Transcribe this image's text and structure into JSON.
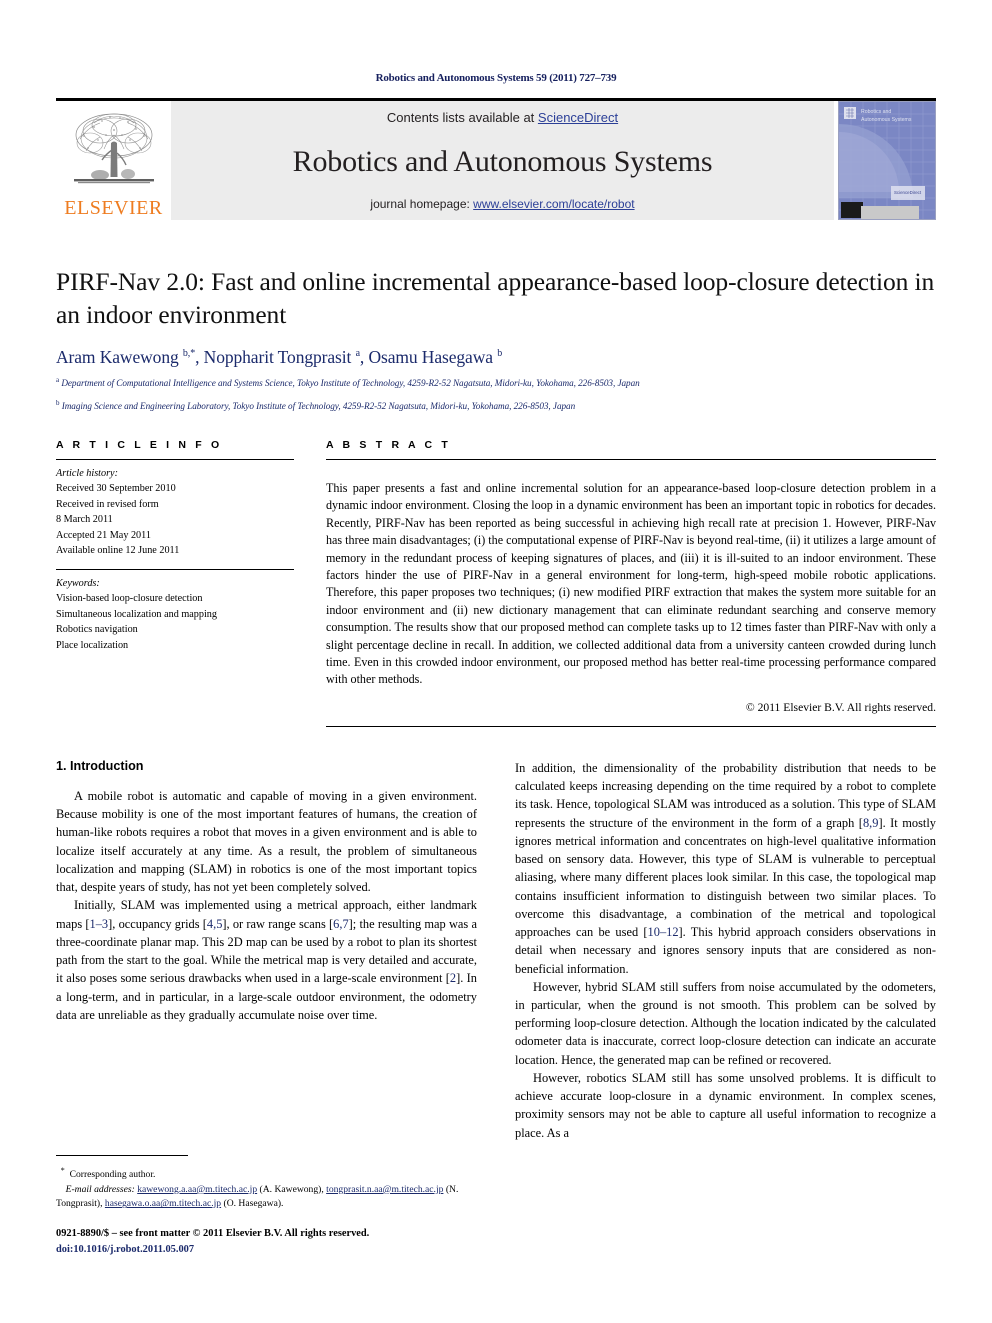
{
  "running_head": "Robotics and Autonomous Systems 59 (2011) 727–739",
  "masthead": {
    "publisher_name": "ELSEVIER",
    "contents_prefix": "Contents lists available at ",
    "contents_link": "ScienceDirect",
    "journal_name": "Robotics and Autonomous Systems",
    "homepage_prefix": "journal homepage: ",
    "homepage_link": "www.elsevier.com/locate/robot",
    "cover_title_line1": "Robotics and",
    "cover_title_line2": "Autonomous Systems",
    "cover_badge": "ScienceDirect"
  },
  "article": {
    "title": "PIRF-Nav 2.0: Fast and online incremental appearance-based loop-closure detection in an indoor environment",
    "authors_html": "Aram Kawewong <sup>b,*</sup>, Noppharit Tongprasit <sup>a</sup>, Osamu Hasegawa <sup>b</sup>",
    "affiliation_a": "Department of Computational Intelligence and Systems Science, Tokyo Institute of Technology, 4259-R2-52 Nagatsuta, Midori-ku, Yokohama, 226-8503, Japan",
    "affiliation_b": "Imaging Science and Engineering Laboratory, Tokyo Institute of Technology, 4259-R2-52 Nagatsuta, Midori-ku, Yokohama, 226-8503, Japan"
  },
  "article_info": {
    "heading": "A R T I C L E   I N F O",
    "history_label": "Article history:",
    "history": [
      "Received 30 September 2010",
      "Received in revised form",
      "8 March 2011",
      "Accepted 21 May 2011",
      "Available online 12 June 2011"
    ],
    "keywords_label": "Keywords:",
    "keywords": [
      "Vision-based loop-closure detection",
      "Simultaneous localization and mapping",
      "Robotics navigation",
      "Place localization"
    ]
  },
  "abstract": {
    "heading": "A B S T R A C T",
    "text": "This paper presents a fast and online incremental solution for an appearance-based loop-closure detection problem in a dynamic indoor environment. Closing the loop in a dynamic environment has been an important topic in robotics for decades. Recently, PIRF-Nav has been reported as being successful in achieving high recall rate at precision 1. However, PIRF-Nav has three main disadvantages; (i) the computational expense of PIRF-Nav is beyond real-time, (ii) it utilizes a large amount of memory in the redundant process of keeping signatures of places, and (iii) it is ill-suited to an indoor environment. These factors hinder the use of PIRF-Nav in a general environment for long-term, high-speed mobile robotic applications. Therefore, this paper proposes two techniques; (i) new modified PIRF extraction that makes the system more suitable for an indoor environment and (ii) new dictionary management that can eliminate redundant searching and conserve memory consumption. The results show that our proposed method can complete tasks up to 12 times faster than PIRF-Nav with only a slight percentage decline in recall. In addition, we collected additional data from a university canteen crowded during lunch time. Even in this crowded indoor environment, our proposed method has better real-time processing performance compared with other methods.",
    "copyright": "© 2011 Elsevier B.V. All rights reserved."
  },
  "body": {
    "section_title": "1.  Introduction",
    "left_paragraphs": [
      "A mobile robot is automatic and capable of moving in a given environment. Because mobility is one of the most important features of humans, the creation of human-like robots requires a robot that moves in a given environment and is able to localize itself accurately at any time. As a result, the problem of simultaneous localization and mapping (SLAM) in robotics is one of the most important topics that, despite years of study, has not yet been completely solved."
    ],
    "left_para2_parts": {
      "t1": "Initially, SLAM was implemented using a metrical approach, either landmark maps [",
      "r1": "1–3",
      "t2": "], occupancy grids [",
      "r2": "4,5",
      "t3": "], or raw range scans [",
      "r3": "6,7",
      "t4": "]; the resulting map was a three-coordinate planar map. This 2D map can be used by a robot to plan its shortest path from the start to the goal. While the metrical map is very detailed and accurate, it also poses some serious drawbacks when used in a large-scale environment [",
      "r4": "2",
      "t5": "]. In a long-term, and in particular, in a large-scale outdoor environment, the odometry data are unreliable as they gradually accumulate noise over time."
    },
    "right_para1_parts": {
      "t1": "In addition, the dimensionality of the probability distribution that needs to be calculated keeps increasing depending on the time required by a robot to complete its task. Hence, topological SLAM was introduced as a solution. This type of SLAM represents the structure of the environment in the form of a graph [",
      "r1": "8,9",
      "t2": "]. It mostly ignores metrical information and concentrates on high-level qualitative information based on sensory data. However, this type of SLAM is vulnerable to perceptual aliasing, where many different places look similar. In this case, the topological map contains insufficient information to distinguish between two similar places. To overcome this disadvantage, a combination of the metrical and topological approaches can be used [",
      "r2": "10–12",
      "t3": "]. This hybrid approach considers observations in detail when necessary and ignores sensory inputs that are considered as non-beneficial information."
    },
    "right_paragraphs": [
      "However, hybrid SLAM still suffers from noise accumulated by the odometers, in particular, when the ground is not smooth. This problem can be solved by performing loop-closure detection. Although the location indicated by the calculated odometer data is inaccurate, correct loop-closure detection can indicate an accurate location. Hence, the generated map can be refined or recovered.",
      "However, robotics SLAM still has some unsolved problems. It is difficult to achieve accurate loop-closure in a dynamic environment. In complex scenes, proximity sensors may not be able to capture all useful information to recognize a place. As a"
    ]
  },
  "footnote": {
    "corresponding_marker": "*",
    "corresponding_text": "Corresponding author.",
    "email_label": "E-mail addresses:",
    "email1": "kawewong.a.aa@m.titech.ac.jp",
    "email1_name": "(A. Kawewong),",
    "email2": "tongprasit.n.aa@m.titech.ac.jp",
    "email2_name": "(N. Tongprasit),",
    "email3": "hasegawa.o.aa@m.titech.ac.jp",
    "email3_name": "(O. Hasegawa).",
    "issn_line": "0921-8890/$ – see front matter © 2011 Elsevier B.V. All rights reserved.",
    "doi_line": "doi:10.1016/j.robot.2011.05.007"
  },
  "colors": {
    "link_blue": "#2b3f97",
    "navy": "#1b2a6b",
    "elsevier_orange": "#ee7c20",
    "masthead_gray": "#ececec"
  }
}
